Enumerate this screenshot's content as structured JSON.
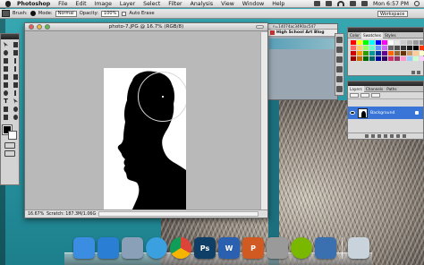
{
  "menubar": {
    "app_name": "Photoshop",
    "items": [
      "File",
      "Edit",
      "Image",
      "Layer",
      "Select",
      "Filter",
      "Analysis",
      "View",
      "Window",
      "Help"
    ],
    "clock": "Mon 6:57 PM"
  },
  "options_bar": {
    "brush_label": "Brush:",
    "mode_label": "Mode:",
    "mode_value": "Normal",
    "opacity_label": "Opacity:",
    "opacity_value": "100%",
    "auto_erase_label": "Auto Erase",
    "workspace_label": "Workspace"
  },
  "tools": {
    "badge": "Ps",
    "type_tool": "T"
  },
  "document": {
    "title": "photo-7.JPG @ 16.7% (RGB/8)",
    "zoom": "16.67%",
    "scratch": "Scratch: 187.3M/1.06G"
  },
  "browser": {
    "address": "n=14074ac3490ac547",
    "tab_title": "High School Art Blog"
  },
  "color_panel": {
    "tabs": [
      "Color",
      "Swatches",
      "Styles"
    ],
    "active_tab": "Swatches",
    "swatch_colors": [
      "#ff0000",
      "#ffff00",
      "#00ff00",
      "#00ffff",
      "#0000ff",
      "#ff00ff",
      "#ffffff",
      "#e6e6e6",
      "#cccccc",
      "#b3b3b3",
      "#999999",
      "#808080",
      "#ff6666",
      "#ffcc66",
      "#99ff66",
      "#66ffcc",
      "#6699ff",
      "#cc66ff",
      "#666666",
      "#4d4d4d",
      "#333333",
      "#1a1a1a",
      "#000000",
      "#ff3300",
      "#cc0000",
      "#ff9900",
      "#339900",
      "#009999",
      "#003399",
      "#660099",
      "#ff6600",
      "#996633",
      "#663300",
      "#cc9966",
      "#ffcc99",
      "#ffffcc",
      "#990000",
      "#cc6600",
      "#006600",
      "#006666",
      "#000099",
      "#330066",
      "#cc3366",
      "#993366",
      "#ff99cc",
      "#99ccff",
      "#ccffcc",
      "#ffccff"
    ]
  },
  "layers_panel": {
    "tabs": [
      "Layers",
      "Channels",
      "Paths"
    ],
    "active_tab": "Layers",
    "layer_name": "Background"
  },
  "dock": {
    "apps": [
      {
        "name": "finder",
        "color": "#3a8de0",
        "label": ""
      },
      {
        "name": "app-store",
        "color": "#2a7fd4",
        "label": ""
      },
      {
        "name": "preview",
        "color": "#8aa0b8",
        "label": ""
      },
      {
        "name": "itunes",
        "color": "#3aa0e0",
        "label": ""
      },
      {
        "name": "chrome",
        "color": "#e8e8e8",
        "label": ""
      },
      {
        "name": "photoshop",
        "color": "#0f3f66",
        "label": "Ps"
      },
      {
        "name": "word",
        "color": "#2b5fb0",
        "label": "W"
      },
      {
        "name": "powerpoint",
        "color": "#d05a22",
        "label": "P"
      },
      {
        "name": "calculator",
        "color": "#9a9a9a",
        "label": ""
      },
      {
        "name": "spotify",
        "color": "#7ab800",
        "label": ""
      },
      {
        "name": "quicktime",
        "color": "#3a6fb0",
        "label": ""
      },
      {
        "name": "trash",
        "color": "#c9d3dc",
        "label": ""
      }
    ]
  }
}
